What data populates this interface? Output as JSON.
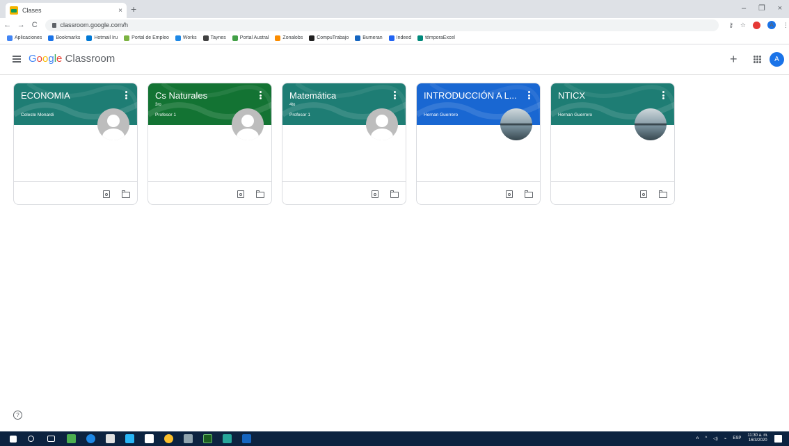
{
  "browser": {
    "tab_title": "Clases",
    "tab_close": "×",
    "new_tab": "+",
    "window_controls": [
      "–",
      "❐",
      "×"
    ],
    "url": "classroom.google.com/h",
    "profile_initial": "A"
  },
  "bookmarks": [
    {
      "label": "Aplicaciones",
      "color": "#4285f4"
    },
    {
      "label": "Bookmarks",
      "color": "#1a73e8"
    },
    {
      "label": "Hotmail Iru",
      "color": "#0078d4"
    },
    {
      "label": "Portal de Empleo",
      "color": "#7cb342"
    },
    {
      "label": "Works",
      "color": "#1e88e5"
    },
    {
      "label": "Taynes",
      "color": "#424242"
    },
    {
      "label": "Portal Austral",
      "color": "#43a047"
    },
    {
      "label": "Zonalobs",
      "color": "#fb8c00"
    },
    {
      "label": "CompuTrabajo",
      "color": "#212121"
    },
    {
      "label": "Bumeran",
      "color": "#1565c0"
    },
    {
      "label": "Indeed",
      "color": "#2164f3"
    },
    {
      "label": "témporaExcel",
      "color": "#00897b"
    }
  ],
  "header": {
    "brand_google": "Google",
    "brand_product": "Classroom",
    "add_label": "+",
    "user_initial": "A"
  },
  "colors": {
    "green": "#137333",
    "teal": "#1e7d74",
    "blue": "#1967d2"
  },
  "classes": [
    {
      "title": "ECONOMIA",
      "section": "",
      "teacher": "Celeste Monardi",
      "theme": "teal",
      "avatar": "generic"
    },
    {
      "title": "Cs Naturales",
      "section": "3ro",
      "teacher": "Profesor 1",
      "theme": "green",
      "avatar": "generic"
    },
    {
      "title": "Matemática",
      "section": "4to",
      "teacher": "Profesor 1",
      "theme": "teal",
      "avatar": "generic"
    },
    {
      "title": "INTRODUCCIÓN A L...",
      "section": "",
      "teacher": "Hernan Guerrero",
      "theme": "blue",
      "avatar": "photo"
    },
    {
      "title": "NTICX",
      "section": "",
      "teacher": "Hernan Guerrero",
      "theme": "teal",
      "avatar": "photo"
    }
  ],
  "help_label": "?",
  "taskbar": {
    "time": "11:30 a. m.",
    "date": "16/3/2020",
    "language": "ESP"
  }
}
